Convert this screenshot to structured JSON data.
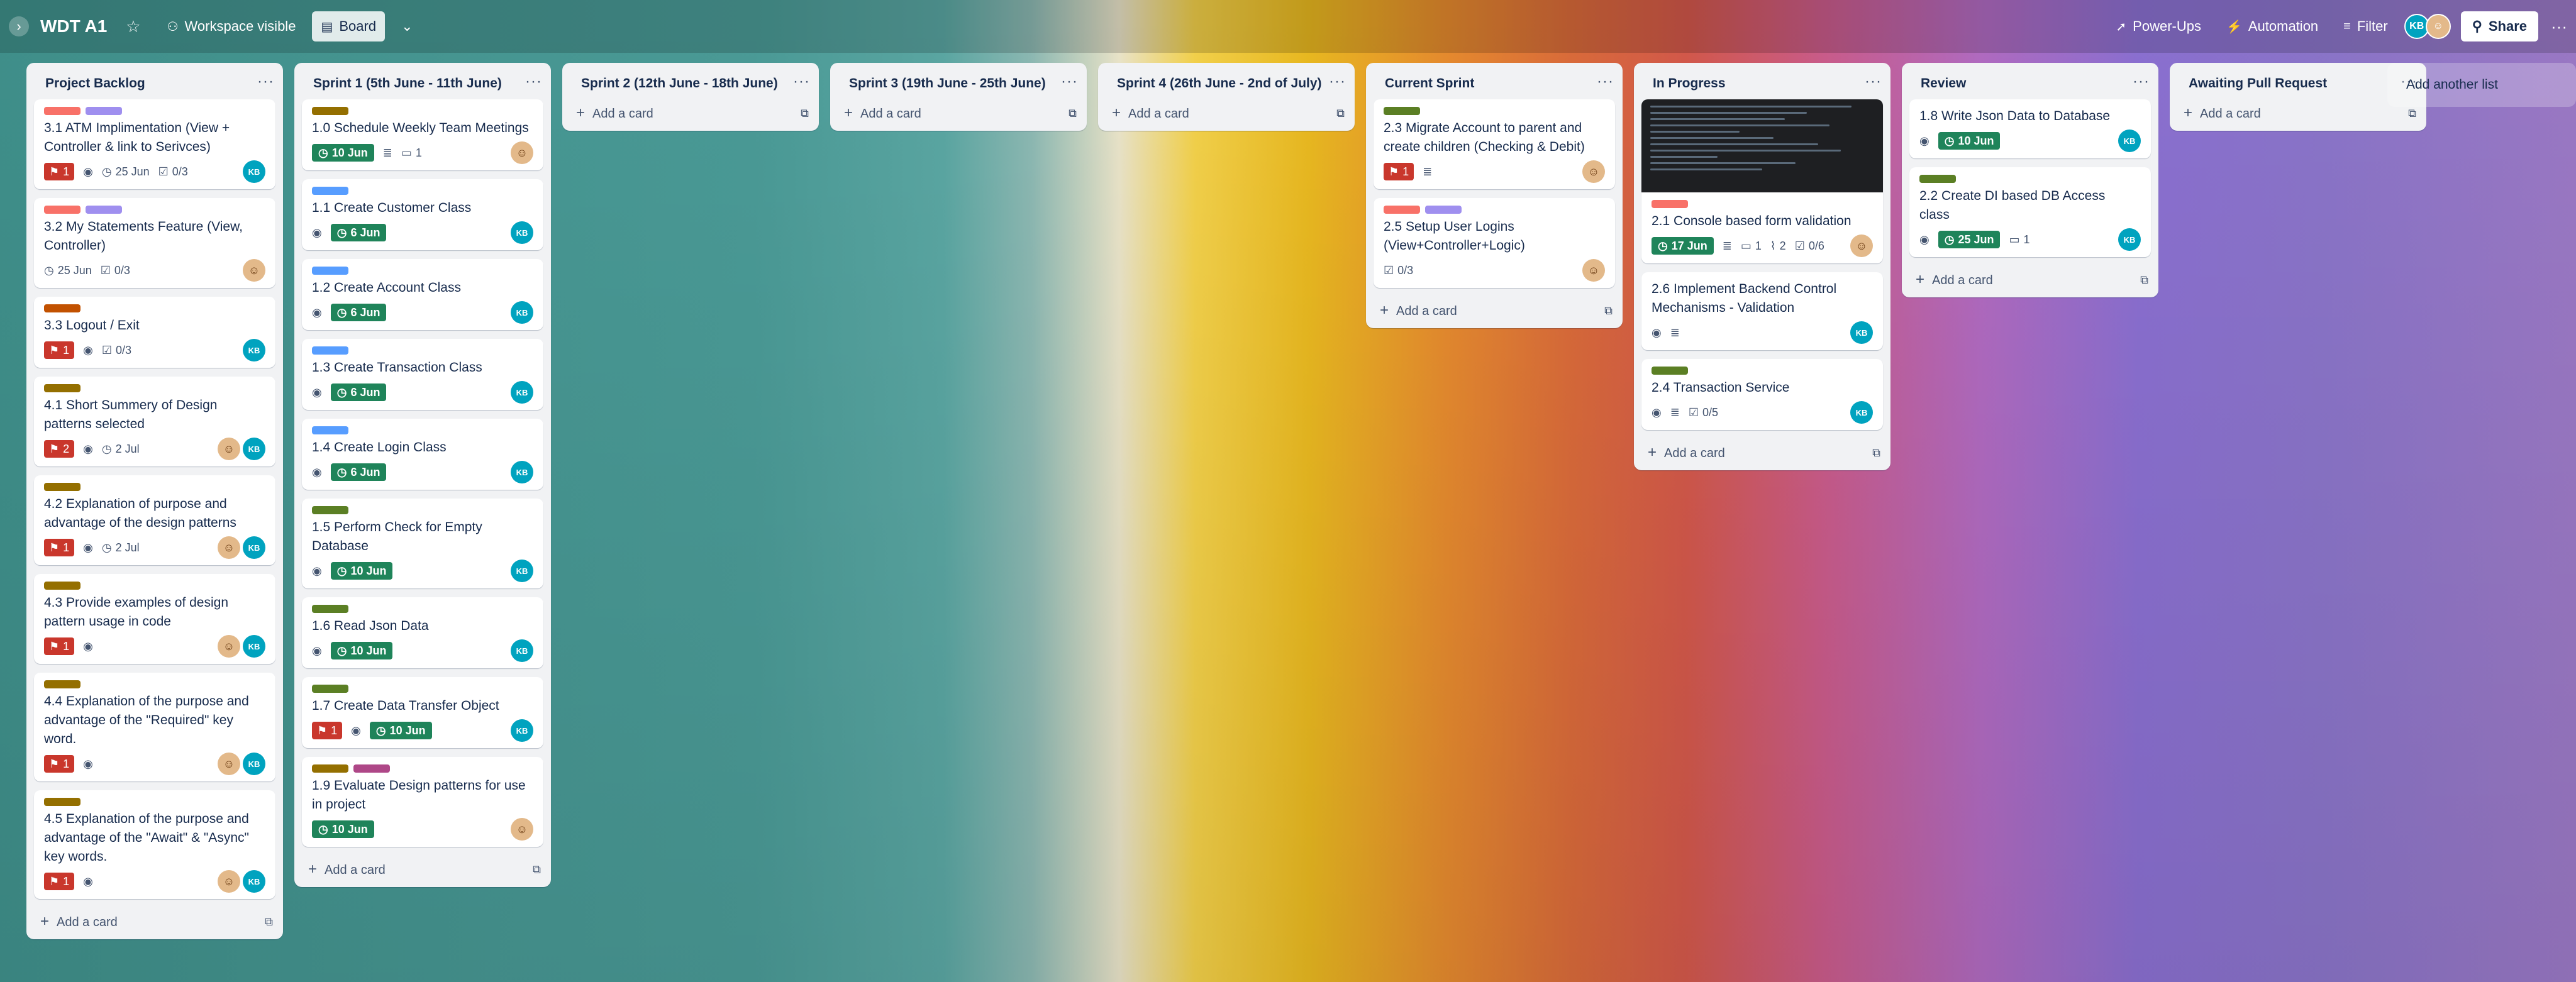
{
  "header": {
    "board_title": "WDT A1",
    "visibility": "Workspace visible",
    "view": "Board",
    "powerups": "Power-Ups",
    "automation": "Automation",
    "filter": "Filter",
    "share": "Share",
    "member_initials": "KB"
  },
  "lists": [
    {
      "title": "Project Backlog",
      "add": "Add a card",
      "cards": [
        {
          "title": "3.1 ATM Implimentation (View + Controller & link to Serivces)",
          "labels": [
            "#f87168",
            "#9f8fef"
          ],
          "prio": "1",
          "watch": true,
          "date_plain": "25 Jun",
          "checklist": "0/3",
          "members": [
            "kb"
          ]
        },
        {
          "title": "3.2 My Statements Feature (View, Controller)",
          "labels": [
            "#f87168",
            "#9f8fef"
          ],
          "date_plain": "25 Jun",
          "checklist": "0/3",
          "members": [
            "ph"
          ]
        },
        {
          "title": "3.3 Logout / Exit",
          "labels": [
            "#c25100"
          ],
          "prio": "1",
          "watch": true,
          "checklist": "0/3",
          "members": [
            "kb"
          ]
        },
        {
          "title": "4.1 Short Summery of Design patterns selected",
          "labels": [
            "#946f00"
          ],
          "prio": "2",
          "watch": true,
          "date_plain": "2 Jul",
          "members": [
            "ph",
            "kb"
          ]
        },
        {
          "title": "4.2 Explanation of purpose and advantage of the design patterns",
          "labels": [
            "#946f00"
          ],
          "prio": "1",
          "watch": true,
          "date_plain": "2 Jul",
          "members": [
            "ph",
            "kb"
          ]
        },
        {
          "title": "4.3 Provide examples of design pattern usage in code",
          "labels": [
            "#946f00"
          ],
          "prio": "1",
          "watch": true,
          "members": [
            "ph",
            "kb"
          ]
        },
        {
          "title": "4.4 Explanation of the purpose and advantage of the \"Required\" key word.",
          "labels": [
            "#946f00"
          ],
          "prio": "1",
          "watch": true,
          "members": [
            "ph",
            "kb"
          ]
        },
        {
          "title": "4.5 Explanation of the purpose and advantage of the \"Await\" & \"Async\" key words.",
          "labels": [
            "#946f00"
          ],
          "prio": "1",
          "watch": true,
          "members": [
            "ph",
            "kb"
          ]
        }
      ]
    },
    {
      "title": "Sprint 1 (5th June - 11th June)",
      "add": "Add a card",
      "cards": [
        {
          "title": "1.0 Schedule Weekly Team Meetings",
          "labels": [
            "#946f00"
          ],
          "date": "10 Jun",
          "desc": true,
          "comments": "1",
          "members": [
            "ph"
          ]
        },
        {
          "title": "1.1 Create Customer Class",
          "labels": [
            "#579dff"
          ],
          "watch": true,
          "date": "6 Jun",
          "members": [
            "kb"
          ]
        },
        {
          "title": "1.2 Create Account Class",
          "labels": [
            "#579dff"
          ],
          "watch": true,
          "date": "6 Jun",
          "members": [
            "kb"
          ]
        },
        {
          "title": "1.3 Create Transaction Class",
          "labels": [
            "#579dff"
          ],
          "watch": true,
          "date": "6 Jun",
          "members": [
            "kb"
          ]
        },
        {
          "title": "1.4 Create Login Class",
          "labels": [
            "#579dff"
          ],
          "watch": true,
          "date": "6 Jun",
          "members": [
            "kb"
          ]
        },
        {
          "title": "1.5 Perform Check for Empty Database",
          "labels": [
            "#5b7f24"
          ],
          "watch": true,
          "date": "10 Jun",
          "members": [
            "kb"
          ]
        },
        {
          "title": "1.6 Read Json Data",
          "labels": [
            "#5b7f24"
          ],
          "watch": true,
          "date": "10 Jun",
          "members": [
            "kb"
          ]
        },
        {
          "title": "1.7 Create Data Transfer Object",
          "labels": [
            "#5b7f24"
          ],
          "prio": "1",
          "watch": true,
          "date": "10 Jun",
          "members": [
            "kb"
          ]
        },
        {
          "title": "1.9 Evaluate Design patterns for use in project",
          "labels": [
            "#946f00",
            "#ae4787"
          ],
          "date": "10 Jun",
          "members": [
            "ph"
          ]
        }
      ]
    },
    {
      "title": "Sprint 2 (12th June - 18th June)",
      "add": "Add a card",
      "cards": []
    },
    {
      "title": "Sprint 3 (19th June - 25th June)",
      "add": "Add a card",
      "cards": []
    },
    {
      "title": "Sprint 4 (26th June - 2nd of July)",
      "add": "Add a card",
      "cards": []
    },
    {
      "title": "Current Sprint",
      "add": "Add a card",
      "cards": [
        {
          "title": "2.3 Migrate Account to parent and create children (Checking & Debit)",
          "labels": [
            "#5b7f24"
          ],
          "prio": "1",
          "desc": true,
          "members": [
            "ph"
          ]
        },
        {
          "title": "2.5 Setup User Logins (View+Controller+Logic)",
          "labels": [
            "#f87168",
            "#9f8fef"
          ],
          "checklist": "0/3",
          "members": [
            "ph"
          ]
        }
      ]
    },
    {
      "title": "In Progress",
      "add": "Add a card",
      "cards": [
        {
          "title": "2.1 Console based form validation",
          "cover": true,
          "labels": [
            "#f87168"
          ],
          "date": "17 Jun",
          "desc": true,
          "comments": "1",
          "attachments": "2",
          "checklist": "0/6",
          "members": [
            "ph"
          ]
        },
        {
          "title": "2.6 Implement Backend Control Mechanisms - Validation",
          "labels": [],
          "watch": true,
          "desc": true,
          "members": [
            "kb"
          ]
        },
        {
          "title": "2.4 Transaction Service",
          "labels": [
            "#5b7f24"
          ],
          "watch": true,
          "desc": true,
          "checklist": "0/5",
          "members": [
            "kb"
          ]
        }
      ]
    },
    {
      "title": "Review",
      "add": "Add a card",
      "cards": [
        {
          "title": "1.8 Write Json Data to Database",
          "labels": [],
          "watch": true,
          "date": "10 Jun",
          "members": [
            "kb"
          ]
        },
        {
          "title": "2.2 Create DI based DB Access class",
          "labels": [
            "#5b7f24"
          ],
          "watch": true,
          "date": "25 Jun",
          "comments": "1",
          "members": [
            "kb"
          ]
        }
      ]
    },
    {
      "title": "Awaiting Pull Request",
      "add": "Add a card",
      "cards": []
    }
  ],
  "add_list": "Add another list",
  "icons": {
    "priority": "priority-icon",
    "watch": "eye-icon",
    "clock": "clock-icon",
    "checklist": "checklist-icon",
    "description": "description-icon",
    "comment": "comment-icon",
    "attachment": "paperclip-icon"
  }
}
